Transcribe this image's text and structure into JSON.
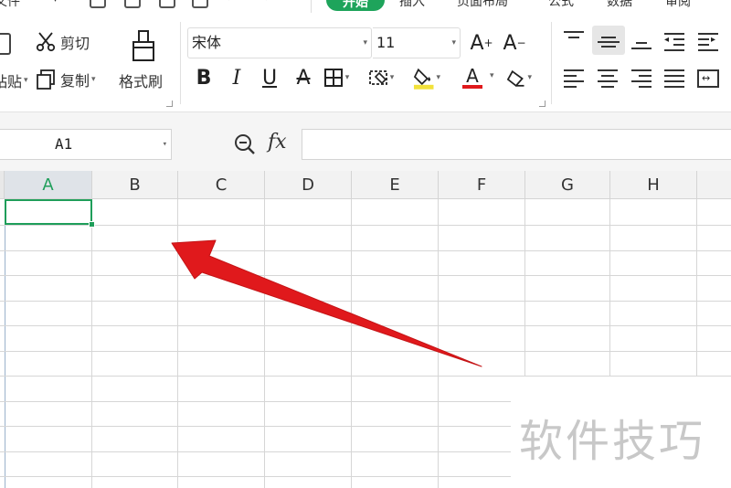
{
  "menubar": {
    "file_label": "文件",
    "tabs": [
      "开始",
      "插入",
      "页面布局",
      "公式",
      "数据",
      "审阅"
    ]
  },
  "ribbon": {
    "cut_label": "剪切",
    "paste_label": "粘贴",
    "copy_label": "复制",
    "format_painter_label": "格式刷",
    "font_name": "宋体",
    "font_size": "11",
    "grow_font": "A",
    "shrink_font": "A",
    "bold": "B",
    "italic": "I",
    "underline": "U",
    "strike": "A",
    "font_color_letter": "A"
  },
  "formula_bar": {
    "name_box": "A1",
    "fx": "fx",
    "formula": ""
  },
  "grid": {
    "columns": [
      "A",
      "B",
      "C",
      "D",
      "E",
      "F",
      "G",
      "H"
    ],
    "selected_cell": "A1"
  },
  "watermark": "软件技巧",
  "colors": {
    "accent": "#1ea45b",
    "arrow": "#e0191c"
  }
}
